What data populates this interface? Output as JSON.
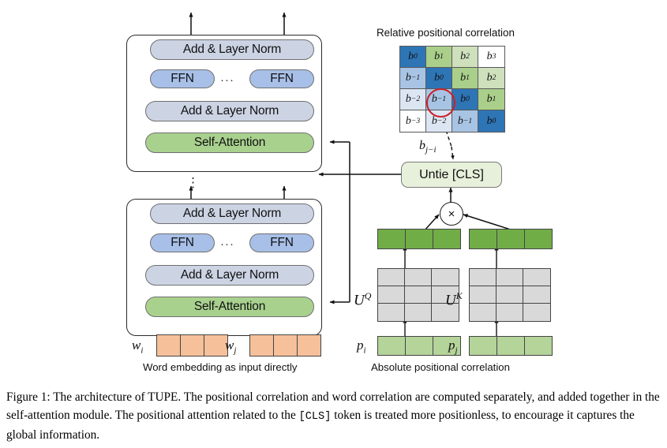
{
  "figure": {
    "caption_part1": "Figure 1: The architecture of TUPE. The positional correlation and word correlation are computed separately, and added together in the self-attention module. The positional attention related to the",
    "caption_cls": "[CLS]",
    "caption_part2": " token is treated more positionless, to encourage it captures the global information."
  },
  "encoder": {
    "add_norm_label": "Add & Layer Norm",
    "ffn_label": "FFN",
    "self_attention_label": "Self-Attention",
    "ffn_ellipsis": "···",
    "stack_ellipsis": "⋮",
    "blocks": [
      {
        "name": "upper-encoder-block",
        "add_norm_top": "Add & Layer Norm",
        "ffn_left": "FFN",
        "ffn_right": "FFN",
        "add_norm_bottom": "Add & Layer Norm",
        "self_attention": "Self-Attention"
      },
      {
        "name": "lower-encoder-block",
        "add_norm_top": "Add & Layer Norm",
        "ffn_left": "FFN",
        "ffn_right": "FFN",
        "add_norm_bottom": "Add & Layer Norm",
        "self_attention": "Self-Attention"
      }
    ]
  },
  "word_embedding": {
    "caption": "Word embedding as input directly",
    "tokens": [
      {
        "label": "w",
        "subscript": "i",
        "cells": 3,
        "color": "#f5c09a"
      },
      {
        "label": "w",
        "subscript": "j",
        "cells": 3,
        "color": "#f5c09a"
      }
    ]
  },
  "relative": {
    "title": "Relative positional correlation",
    "selected_cell": "b−1",
    "arrow_label_base": "b",
    "arrow_label_sub": "j−i",
    "matrix": [
      [
        {
          "base": "b",
          "sub": "0",
          "color": "#2e75b6"
        },
        {
          "base": "b",
          "sub": "1",
          "color": "#a9cf8a"
        },
        {
          "base": "b",
          "sub": "2",
          "color": "#cfe0bc"
        },
        {
          "base": "b",
          "sub": "3",
          "color": "#ffffff"
        }
      ],
      [
        {
          "base": "b",
          "sub": "−1",
          "color": "#a8c4e4"
        },
        {
          "base": "b",
          "sub": "0",
          "color": "#2e75b6"
        },
        {
          "base": "b",
          "sub": "1",
          "color": "#a9cf8a"
        },
        {
          "base": "b",
          "sub": "2",
          "color": "#cfe0bc"
        }
      ],
      [
        {
          "base": "b",
          "sub": "−2",
          "color": "#dce6f3"
        },
        {
          "base": "b",
          "sub": "−1",
          "color": "#a8c4e4"
        },
        {
          "base": "b",
          "sub": "0",
          "color": "#2e75b6"
        },
        {
          "base": "b",
          "sub": "1",
          "color": "#a9cf8a"
        }
      ],
      [
        {
          "base": "b",
          "sub": "−3",
          "color": "#ffffff"
        },
        {
          "base": "b",
          "sub": "−2",
          "color": "#dce6f3"
        },
        {
          "base": "b",
          "sub": "−1",
          "color": "#a8c4e4"
        },
        {
          "base": "b",
          "sub": "0",
          "color": "#2e75b6"
        }
      ]
    ]
  },
  "untie": {
    "label": "Untie [CLS]"
  },
  "multiply": {
    "symbol": "×"
  },
  "absolute": {
    "caption": "Absolute positional correlation",
    "query": {
      "projection_base": "U",
      "projection_sup": "Q",
      "input_base": "p",
      "input_sub": "i",
      "input_cells": 3,
      "output_cells": 3
    },
    "key": {
      "projection_base": "U",
      "projection_sup": "K",
      "input_base": "p",
      "input_sub": "j",
      "input_cells": 3,
      "output_cells": 3
    }
  },
  "colors": {
    "add_norm": "#ccd4e4",
    "ffn": "#a8c0e8",
    "self_attention": "#a9d18e",
    "untie": "#e7f0da",
    "word_vector": "#f5c09a",
    "pos_vector": "#b4d49a",
    "proj_output": "#70ad47",
    "proj_matrix": "#d9d9d9",
    "highlight_ring": "#cc2027",
    "diag_blue": "#2e75b6"
  }
}
